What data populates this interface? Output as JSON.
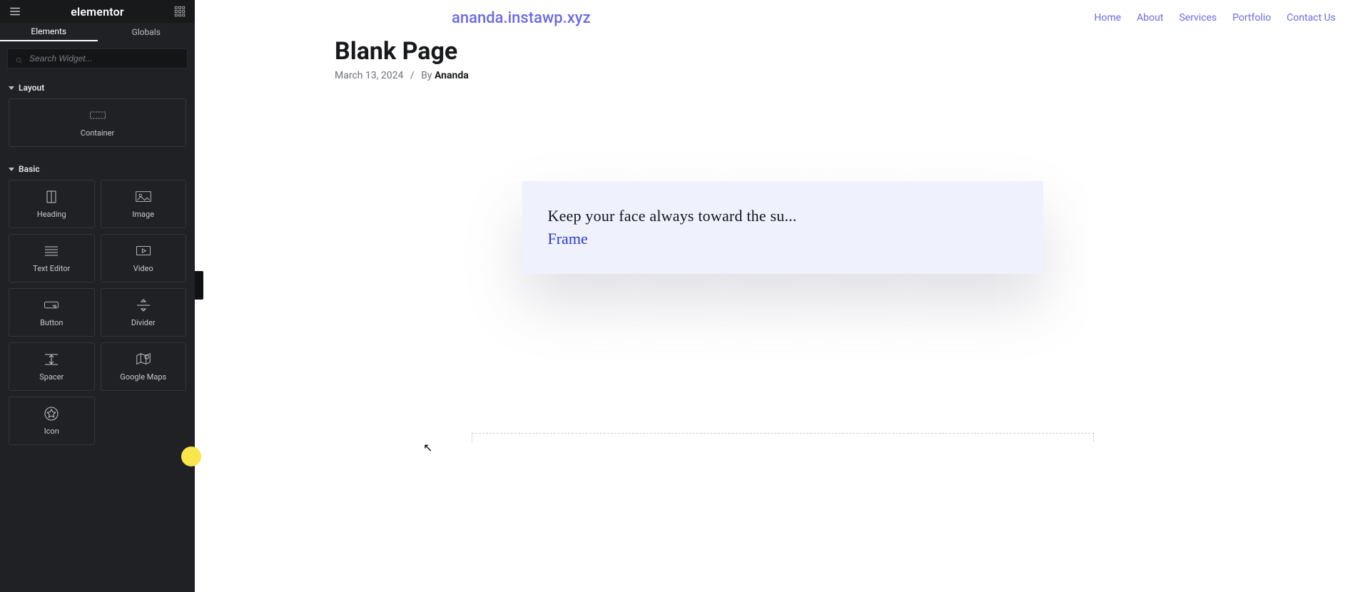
{
  "sidebar": {
    "logo": "elementor",
    "tabs": {
      "elements": "Elements",
      "globals": "Globals"
    },
    "search_placeholder": "Search Widget...",
    "sections": {
      "layout": "Layout",
      "basic": "Basic"
    },
    "widgets": {
      "container": "Container",
      "heading": "Heading",
      "image": "Image",
      "text_editor": "Text Editor",
      "video": "Video",
      "button": "Button",
      "divider": "Divider",
      "spacer": "Spacer",
      "google_maps": "Google Maps",
      "icon": "Icon"
    }
  },
  "site": {
    "brand": "ananda.instawp.xyz",
    "nav": {
      "home": "Home",
      "about": "About",
      "services": "Services",
      "portfolio": "Portfolio",
      "contact": "Contact Us"
    }
  },
  "page": {
    "title": "Blank Page",
    "date": "March 13, 2024",
    "by_prefix": "By",
    "author": "Ananda"
  },
  "hero": {
    "line1": "Keep your face always toward the su...",
    "line2": "Frame"
  }
}
